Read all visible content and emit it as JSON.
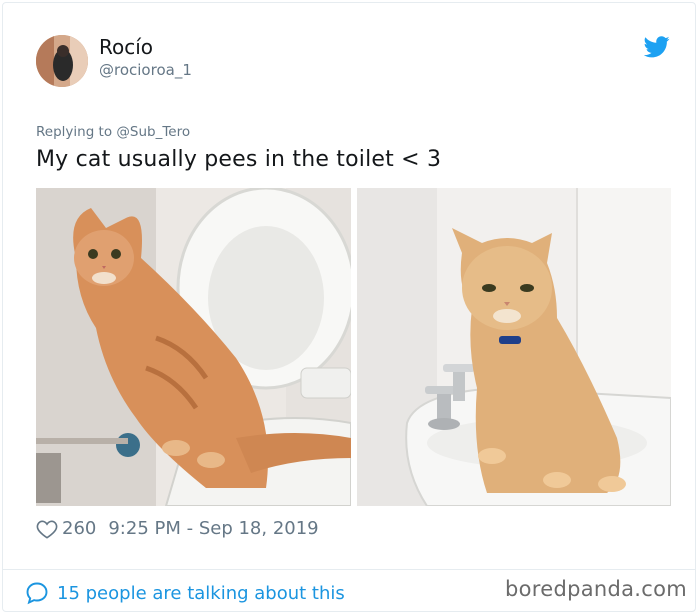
{
  "tweet": {
    "author": {
      "name": "Rocío",
      "handle": "@rocioroa_1"
    },
    "replying_label": "Replying to",
    "replying_to": "@Sub_Tero",
    "text": "My cat usually pees in the toilet < 3",
    "likes": "260",
    "timestamp": "9:25 PM - Sep 18, 2019",
    "conversation_link": "15 people are talking about this"
  },
  "watermark": "boredpanda.com",
  "colors": {
    "twitter_blue": "#1da1f2",
    "link_blue": "#1b95e0",
    "secondary_text": "#657786",
    "primary_text": "#14171a"
  },
  "icons": {
    "brand": "twitter-bird-icon",
    "like": "heart-outline-icon",
    "conversation": "speech-bubble-icon"
  }
}
